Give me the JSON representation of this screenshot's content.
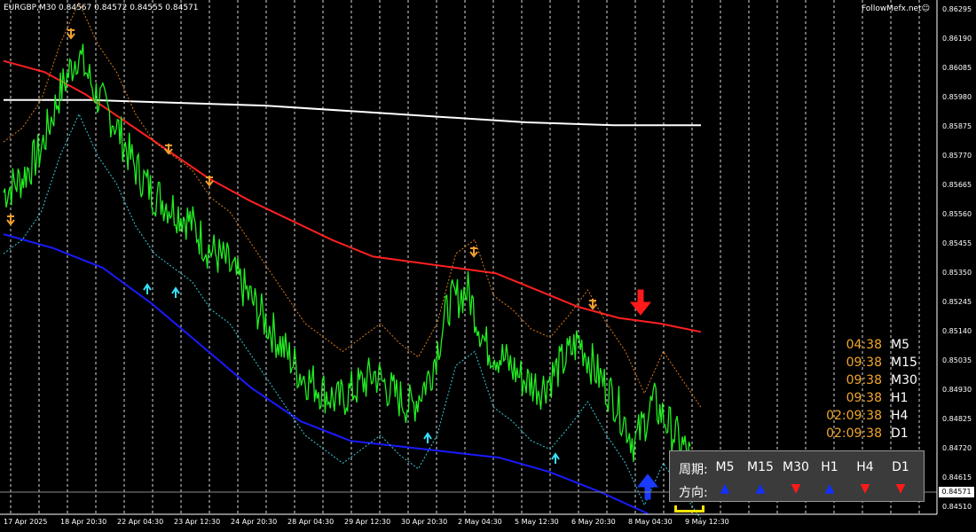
{
  "header": {
    "symbol_info": "EURGBP,M30  0.84567 0.84572 0.84555 0.84571"
  },
  "brand": {
    "text": "FollowMefx.net☺"
  },
  "price_axis": {
    "labels": [
      "0.86295",
      "0.86190",
      "0.86085",
      "0.85980",
      "0.85875",
      "0.85770",
      "0.85665",
      "0.85560",
      "0.85455",
      "0.85350",
      "0.85245",
      "0.85140",
      "0.85035",
      "0.84930",
      "0.84825",
      "0.84720",
      "0.84615",
      "0.84510"
    ],
    "current_price": "0.84571"
  },
  "time_axis": {
    "labels": [
      "17 Apr 2025",
      "18 Apr 20:30",
      "22 Apr 04:30",
      "23 Apr 12:30",
      "24 Apr 20:30",
      "28 Apr 04:30",
      "29 Apr 12:30",
      "30 Apr 20:30",
      "2 May 04:30",
      "5 May 12:30",
      "6 May 20:30",
      "8 May 04:30",
      "9 May 12:30"
    ]
  },
  "timers": [
    {
      "time": "04:38",
      "period": "M5"
    },
    {
      "time": "09:38",
      "period": "M15"
    },
    {
      "time": "09:38",
      "period": "M30"
    },
    {
      "time": "09:38",
      "period": "H1"
    },
    {
      "time": "02:09:38",
      "period": "H4"
    },
    {
      "time": "02:09:38",
      "period": "D1"
    }
  ],
  "direction_panel": {
    "period_label": "周期:",
    "direction_label": "方向:",
    "periods": [
      "M5",
      "M15",
      "M30",
      "H1",
      "H4",
      "D1"
    ],
    "directions": [
      "up",
      "up",
      "down",
      "up",
      "down",
      "down"
    ],
    "up_color": "#1230ff",
    "down_color": "#ff1a1a"
  },
  "chart_data": {
    "type": "line",
    "symbol": "EURGBP",
    "timeframe": "M30",
    "ylim": [
      0.8451,
      0.863
    ],
    "grid": true,
    "series": [
      {
        "values": [
          0.8565,
          0.857,
          0.858,
          0.86,
          0.8615,
          0.86,
          0.859,
          0.8575,
          0.8565,
          0.856,
          0.8555,
          0.8545,
          0.854,
          0.853,
          0.852,
          0.851,
          0.85,
          0.8495,
          0.849,
          0.8495,
          0.85,
          0.8493,
          0.8488,
          0.85,
          0.8525,
          0.853,
          0.851,
          0.8505,
          0.8498,
          0.8495,
          0.8503,
          0.8512,
          0.85,
          0.849,
          0.8475,
          0.849,
          0.848,
          0.847
        ]
      },
      {
        "values": [
          0.8612,
          0.8608,
          0.86,
          0.859,
          0.858,
          0.857,
          0.8562,
          0.8555,
          0.8548,
          0.8542,
          0.854,
          0.8538,
          0.8536,
          0.853,
          0.8524,
          0.852,
          0.8518,
          0.8515
        ]
      },
      {
        "values": [
          0.8598,
          0.8598,
          0.8597,
          0.8596,
          0.8594,
          0.8592,
          0.859,
          0.8589,
          0.8589
        ]
      },
      {
        "values": [
          0.855,
          0.8545,
          0.8538,
          0.8525,
          0.851,
          0.8495,
          0.8483,
          0.8476,
          0.8474,
          0.8472,
          0.847,
          0.8465,
          0.8458,
          0.845
        ]
      }
    ],
    "signals": [
      {
        "type": "sell"
      },
      {
        "type": "sell"
      },
      {
        "type": "sell"
      },
      {
        "type": "sell"
      },
      {
        "type": "sell"
      },
      {
        "type": "sell"
      },
      {
        "type": "sell_strong"
      },
      {
        "type": "buy"
      },
      {
        "type": "buy"
      },
      {
        "type": "buy"
      },
      {
        "type": "buy"
      },
      {
        "type": "buy_strong"
      },
      {
        "type": "buy"
      }
    ],
    "colors": {
      "price": "#22ee22",
      "ma_slow": "#ff2020",
      "ma_long": "#ffffff",
      "lower_channel": "#1a1aff",
      "dotted_upper": "#d87a1a",
      "dotted_lower": "#37c8d8"
    }
  }
}
